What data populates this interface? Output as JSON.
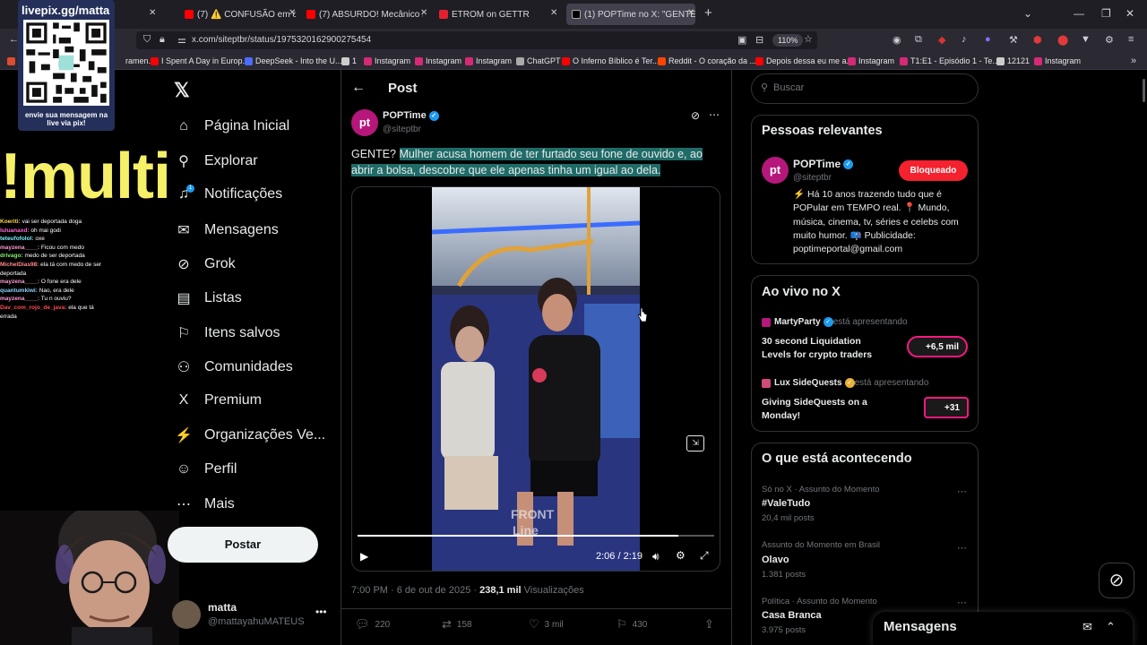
{
  "browser": {
    "tabs": [
      {
        "label": "",
        "color": "#2b2a33"
      },
      {
        "label": "(7) ⚠️ CONFUSÃO em oficina t",
        "color": "#ff0000"
      },
      {
        "label": "(7) ABSURDO! Mecânico ENGAI",
        "color": "#ff0000"
      },
      {
        "label": "ETROM on GETTR",
        "color": "#e5202e"
      },
      {
        "label": "(1) POPTime no X: \"GENTE? Mu",
        "color": "#000000"
      }
    ],
    "url": "x.com/siteptbr/status/1975320162900275454",
    "zoom": "110%",
    "bookmarks": [
      {
        "label": "ramen...",
        "color": "#e04a2f"
      },
      {
        "label": "I Spent A Day in Europ...",
        "color": "#ff0000"
      },
      {
        "label": "DeepSeek - Into the U...",
        "color": "#4d6bfe"
      },
      {
        "label": "1",
        "color": "#cccccc"
      },
      {
        "label": "Instagram",
        "color": "#d62976"
      },
      {
        "label": "Instagram",
        "color": "#d62976"
      },
      {
        "label": "Instagram",
        "color": "#d62976"
      },
      {
        "label": "ChatGPT",
        "color": "#aaaaaa"
      },
      {
        "label": "O Inferno Bíblico é Ter...",
        "color": "#ff0000"
      },
      {
        "label": "Reddit - O coração da ...",
        "color": "#ff4500"
      },
      {
        "label": "Depois dessa eu me a...",
        "color": "#ff0000"
      },
      {
        "label": "Instagram",
        "color": "#d62976"
      },
      {
        "label": "T1:E1 - Episódio 1 - Te...",
        "color": "#d62976"
      },
      {
        "label": "12121",
        "color": "#cccccc"
      },
      {
        "label": "Instagram",
        "color": "#d62976"
      }
    ]
  },
  "overlay": {
    "qr_title": "livepix.gg/matta",
    "qr_caption": "envie sua mensagem na live via pix!",
    "multi_text": "!multi",
    "chat": [
      {
        "user": "Koeriti:",
        "msg": "vai ser deportada doga",
        "color": "#ffd84d"
      },
      {
        "user": "luluanaxd:",
        "msg": "oh mai godi",
        "color": "#ff6bd6"
      },
      {
        "user": "teteufofolol:",
        "msg": "oxe",
        "color": "#7cf0ff"
      },
      {
        "user": "mayzena____:",
        "msg": "Ficou com medo",
        "color": "#ff9ad5"
      },
      {
        "user": "drivago:",
        "msg": "medo de ser deportada",
        "color": "#86f070"
      },
      {
        "user": "MichelDias98:",
        "msg": "ela tá com medo de ser deportada",
        "color": "#ff8a8a"
      },
      {
        "user": "mayzena____:",
        "msg": "O fone era dele",
        "color": "#ff9ad5"
      },
      {
        "user": "quantumkiwi:",
        "msg": "Nao, era dele",
        "color": "#8fd3ff"
      },
      {
        "user": "mayzena____:",
        "msg": "Tu n ouviu?",
        "color": "#ff9ad5"
      },
      {
        "user": "Dav_com_rojo_de_java:",
        "msg": "ela que tá errada",
        "color": "#ff4d4d"
      }
    ]
  },
  "nav": {
    "items": [
      {
        "label": "Página Inicial",
        "icon": "home-icon",
        "glyph": "⌂"
      },
      {
        "label": "Explorar",
        "icon": "search-icon",
        "glyph": "⚲"
      },
      {
        "label": "Notificações",
        "icon": "bell-icon",
        "glyph": "♫"
      },
      {
        "label": "Mensagens",
        "icon": "mail-icon",
        "glyph": "✉"
      },
      {
        "label": "Grok",
        "icon": "grok-icon",
        "glyph": "⊘"
      },
      {
        "label": "Listas",
        "icon": "list-icon",
        "glyph": "▤"
      },
      {
        "label": "Itens salvos",
        "icon": "bookmark-icon",
        "glyph": "⚐"
      },
      {
        "label": "Comunidades",
        "icon": "communities-icon",
        "glyph": "⚇"
      },
      {
        "label": "Premium",
        "icon": "x-icon",
        "glyph": "X"
      },
      {
        "label": "Organizações Ve...",
        "icon": "lightning-icon",
        "glyph": "⚡"
      },
      {
        "label": "Perfil",
        "icon": "profile-icon",
        "glyph": "☺"
      },
      {
        "label": "Mais",
        "icon": "more-circle-icon",
        "glyph": "⋯"
      }
    ],
    "notif_count": "1",
    "post_button": "Postar",
    "account_name": "matta",
    "account_handle": "@mattayahuMATEUS"
  },
  "post": {
    "header": "Post",
    "author_name": "POPTime",
    "author_handle": "@siteptbr",
    "avatar_text": "pt",
    "text_prefix": "GENTE? ",
    "text_highlight": "Mulher acusa homem de ter furtado seu fone de ouvido e, ao abrir a bolsa, descobre que ele apenas tinha um igual ao dela.",
    "video_time": "2:06 / 2:19",
    "video_progress": 0.9,
    "timestamp": "7:00 PM · 6 de out de 2025 · ",
    "views_count": "238,1 mil",
    "views_label": " Visualizações",
    "stats": {
      "replies": "220",
      "reposts": "158",
      "likes": "3 mil",
      "bookmarks": "430"
    }
  },
  "sidebar": {
    "search_placeholder": "Buscar",
    "relevant": {
      "title": "Pessoas relevantes",
      "name": "POPTime",
      "handle": "@siteptbr",
      "button": "Bloqueado",
      "bio": "⚡ Há 10 anos trazendo tudo que é POPular em TEMPO real. 📍 Mundo, música, cinema, tv, séries e celebs com muito humor. 📪 Publicidade: poptimeportal@gmail.com"
    },
    "live": {
      "title": "Ao vivo no X",
      "items": [
        {
          "host": "MartyParty",
          "suffix": " está apresentando",
          "title": "30 second Liquidation Levels for crypto traders",
          "badge": "+6,5 mil"
        },
        {
          "host": "Lux SideQuests",
          "suffix": " está apresentando",
          "title": "Giving SideQuests on a Monday!",
          "badge": "+31"
        }
      ]
    },
    "trends": {
      "title": "O que está acontecendo",
      "items": [
        {
          "category": "Só no X · Assunto do Momento",
          "name": "#ValeTudo",
          "count": "20,4 mil posts"
        },
        {
          "category": "Assunto do Momento em Brasil",
          "name": "Olavo",
          "count": "1.381 posts"
        },
        {
          "category": "Política · Assunto do Momento",
          "name": "Casa Branca",
          "count": "3.975 posts"
        }
      ]
    },
    "messages_title": "Mensagens"
  }
}
